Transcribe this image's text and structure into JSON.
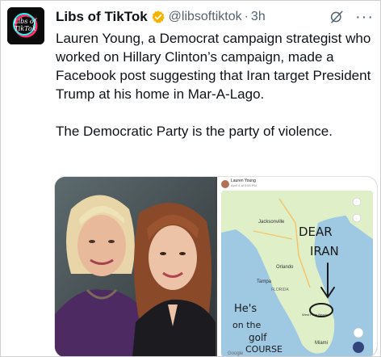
{
  "tweet": {
    "display_name": "Libs of TikTok",
    "handle": "@libsoftiktok",
    "separator": "·",
    "time": "3h",
    "more_label": "···",
    "avatar_text": "Libs of TikTok",
    "paragraphs": [
      "Lauren Young, a Democrat campaign strategist who worked on Hillary Clinton’s campaign, made a Facebook post suggesting that Iran target President Trump at his home in Mar-A-Lago.",
      "The Democratic Party is the party of violence."
    ]
  },
  "screenshot": {
    "poster_name": "Lauren Young",
    "poster_date": "April 4 at 9:00 PM",
    "map_labels": {
      "jacksonville": "Jacksonville",
      "orlando": "Orlando",
      "tampa": "Tampa",
      "florida": "FLORIDA",
      "west_palm": "West Palm Beach",
      "miami": "Miami",
      "google": "Google"
    },
    "handwriting": {
      "dear": "DEAR",
      "iran": "IRAN",
      "hes": "He's",
      "on_the": "on the",
      "golf": "golf",
      "course": "COURSE"
    }
  },
  "colors": {
    "verified_badge": "#f4b400",
    "ocean": "#9fc9e3",
    "land": "#dff0c9",
    "ink": "#1a1a1a"
  }
}
